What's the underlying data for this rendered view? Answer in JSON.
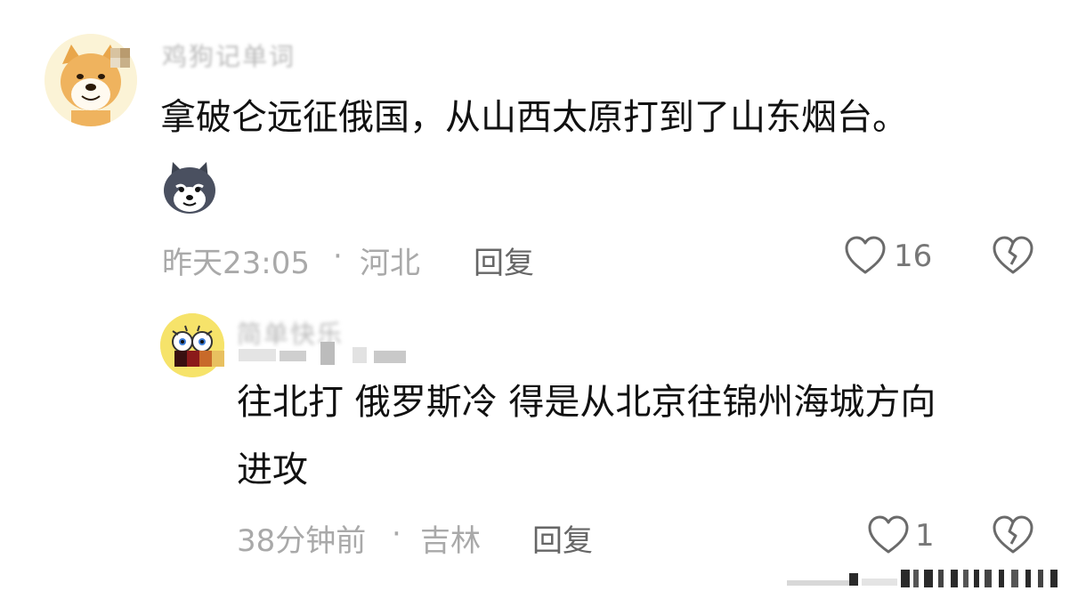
{
  "comments": [
    {
      "username": "鸡狗记单词",
      "text": "拿破仑远征俄国，从山西太原打到了山东烟台。",
      "sticker": "husky-sticker",
      "time": "昨天23:05",
      "separator": "·",
      "location": "河北",
      "reply_label": "回复",
      "likes": "16"
    },
    {
      "username": "简单快乐",
      "text_line1": "往北打 俄罗斯冷 得是从北京往锦州海城方向",
      "text_line2": "进攻",
      "time": "38分钟前",
      "separator": "·",
      "location": "吉林",
      "reply_label": "回复",
      "likes": "1"
    }
  ],
  "icons": {
    "like": "heart-outline-icon",
    "dislike": "broken-heart-icon"
  },
  "colors": {
    "meta": "#a9a9a9",
    "reply": "#666666",
    "text": "#111111"
  }
}
